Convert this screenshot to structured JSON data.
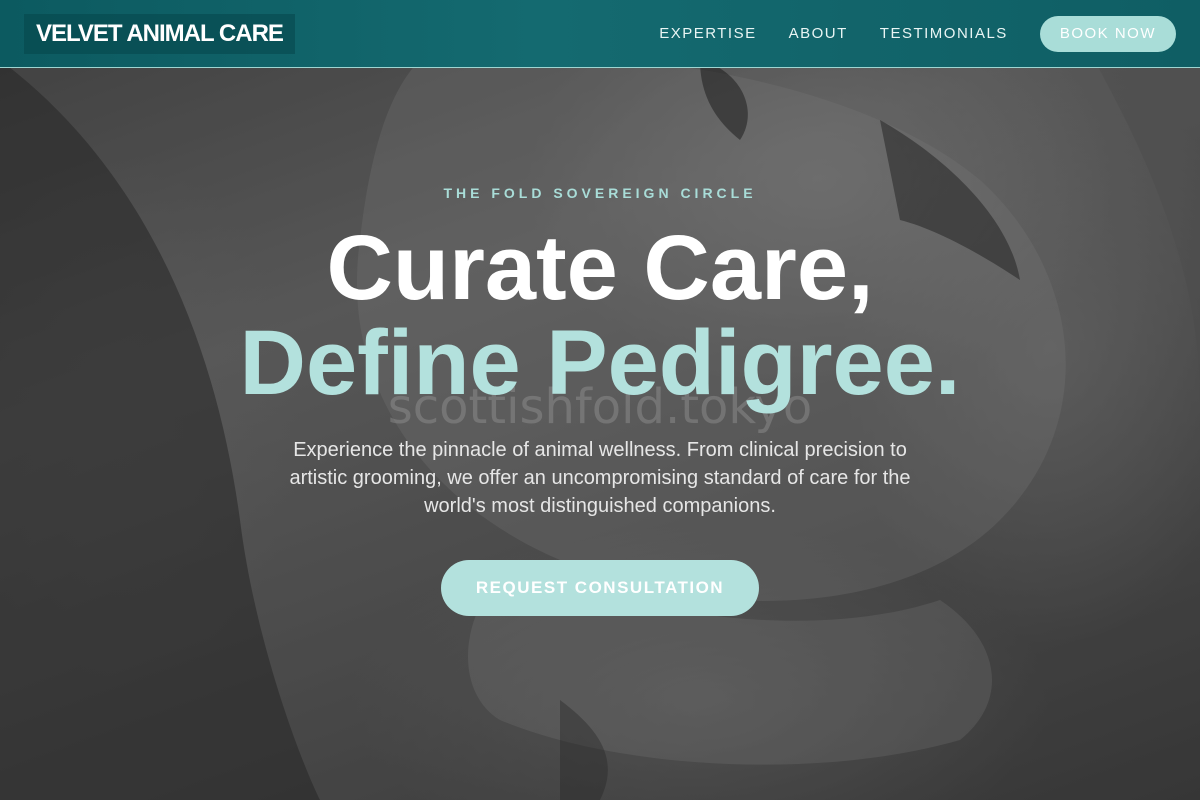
{
  "nav": {
    "brand": "VELVET ANIMAL CARE",
    "links": [
      "EXPERTISE",
      "ABOUT",
      "TESTIMONIALS"
    ],
    "cta": "BOOK NOW"
  },
  "hero": {
    "eyebrow": "THE FOLD SOVEREIGN CIRCLE",
    "headline_line1": "Curate Care,",
    "headline_line2": "Define Pedigree.",
    "watermark": "scottishfold.tokyo",
    "subtext": "Experience the pinnacle of animal wellness. From clinical precision to artistic grooming, we offer an uncompromising standard of care for the world's most distinguished companions.",
    "cta": "REQUEST CONSULTATION",
    "image": "grayscale-cat-closeup-photo"
  },
  "colors": {
    "nav_bg": "#0f5e64",
    "accent": "#b3e1dd",
    "text_light": "#ffffff"
  }
}
